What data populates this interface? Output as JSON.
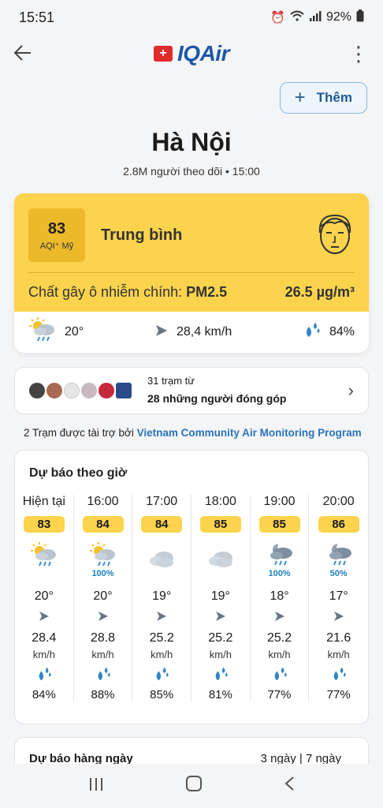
{
  "status_bar": {
    "time": "15:51",
    "battery": "92%",
    "icons": [
      "alarm-icon",
      "wifi-icon",
      "signal-icon",
      "battery-icon"
    ]
  },
  "app_bar": {
    "logo_text": "IQAir",
    "back_icon": "back-arrow-icon",
    "menu_icon": "more-vert-icon"
  },
  "add_button": {
    "label": "Thêm"
  },
  "city": {
    "name": "Hà Nội",
    "followers": "2.8M người theo dõi",
    "time": "15:00"
  },
  "aqi": {
    "value": "83",
    "unit": "AQI⁺ Mỹ",
    "level": "Trung bình",
    "pollutant_label": "Chất gây ô nhiễm chính:",
    "pollutant": "PM2.5",
    "concentration": "26.5 µg/m³",
    "color": "#fbd34d"
  },
  "current_weather": {
    "temp": "20°",
    "wind": "28,4 km/h",
    "humidity": "84%"
  },
  "stations": {
    "line1": "31 trạm từ",
    "line2": "28 những người đóng góp"
  },
  "sponsor": {
    "prefix": "2 Trạm được tài trợ bởi",
    "name": "Vietnam Community Air Monitoring Program"
  },
  "hourly": {
    "title": "Dự báo theo giờ",
    "items": [
      {
        "time": "Hiện tại",
        "aqi": "83",
        "icon": "sun-cloud-rain-icon",
        "rain": "",
        "temp": "20°",
        "speed": "28.4",
        "unit": "km/h",
        "humidity": "84%"
      },
      {
        "time": "16:00",
        "aqi": "84",
        "icon": "sun-cloud-rain-icon",
        "rain": "100%",
        "temp": "20°",
        "speed": "28.8",
        "unit": "km/h",
        "humidity": "88%"
      },
      {
        "time": "17:00",
        "aqi": "84",
        "icon": "cloud-icon",
        "rain": "",
        "temp": "19°",
        "speed": "25.2",
        "unit": "km/h",
        "humidity": "85%"
      },
      {
        "time": "18:00",
        "aqi": "85",
        "icon": "cloud-icon",
        "rain": "",
        "temp": "19°",
        "speed": "25.2",
        "unit": "km/h",
        "humidity": "81%"
      },
      {
        "time": "19:00",
        "aqi": "85",
        "icon": "moon-cloud-rain-icon",
        "rain": "100%",
        "temp": "18°",
        "speed": "25.2",
        "unit": "km/h",
        "humidity": "77%"
      },
      {
        "time": "20:00",
        "aqi": "86",
        "icon": "moon-cloud-rain-icon",
        "rain": "50%",
        "temp": "17°",
        "speed": "21.6",
        "unit": "km/h",
        "humidity": "77%"
      }
    ]
  },
  "daily": {
    "title": "Dự báo hàng ngày",
    "option1": "3 ngày",
    "option2": "7 ngày"
  }
}
